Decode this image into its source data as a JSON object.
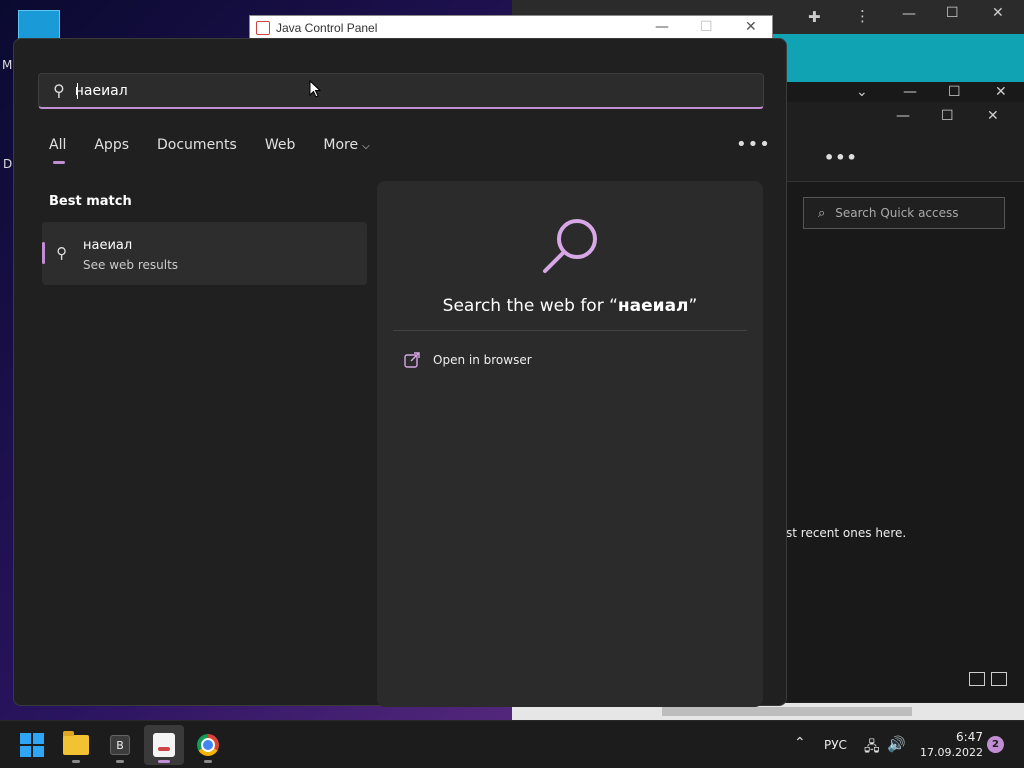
{
  "desktop": {
    "letter_m": "M",
    "letter_d": "D"
  },
  "java_window": {
    "title": "Java Control Panel",
    "minimize": "—",
    "maximize": "☐",
    "close": "✕"
  },
  "explorer": {
    "search_placeholder": "Search Quick access",
    "recent_text": "st recent ones here.",
    "more": "•••"
  },
  "search": {
    "query": "наеиал",
    "tabs": [
      {
        "label": "All"
      },
      {
        "label": "Apps"
      },
      {
        "label": "Documents"
      },
      {
        "label": "Web"
      },
      {
        "label": "More"
      }
    ],
    "more_options": "•••",
    "best_match_label": "Best match",
    "best_match": {
      "title": "наеиал",
      "subtitle": "See web results"
    },
    "preview": {
      "title_prefix": "Search the web for “",
      "query": "наеиал",
      "title_suffix": "”",
      "open_in_browser": "Open in browser"
    }
  },
  "taskbar": {
    "b_label": "B",
    "tray": {
      "language": "РУС",
      "time": "6:47",
      "date": "17.09.2022",
      "notifications": "2"
    }
  },
  "colors": {
    "accent": "#c28ed3",
    "panel_bg": "#202020",
    "preview_bg": "#2b2b2b",
    "browser_accent": "#10a3b4"
  },
  "icons": {
    "search_box": "search-icon",
    "best_match": "search-icon",
    "preview": "search-icon",
    "open_browser": "external-link-icon",
    "tab_more": "chevron-down-icon"
  }
}
